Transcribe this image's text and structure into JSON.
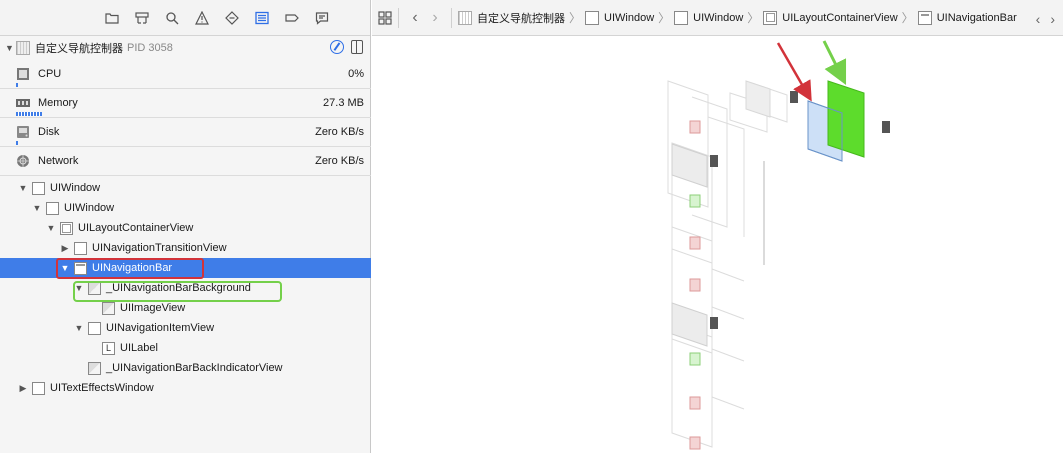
{
  "navigator": {
    "toolbar_icons": [
      "folder-icon",
      "hierarchy-icon",
      "search-icon",
      "warning-icon",
      "test-diamond-icon",
      "debug-list-icon",
      "breakpoint-icon",
      "log-icon"
    ],
    "active_icon": "debug-list-icon",
    "process": {
      "name": "自定义导航控制器",
      "pid": "PID 3058"
    },
    "gauges": [
      {
        "label": "CPU",
        "value": "0%",
        "icon": "cpu-icon"
      },
      {
        "label": "Memory",
        "value": "27.3 MB",
        "icon": "memory-icon"
      },
      {
        "label": "Disk",
        "value": "Zero KB/s",
        "icon": "disk-icon"
      },
      {
        "label": "Network",
        "value": "Zero KB/s",
        "icon": "network-icon"
      }
    ],
    "tree": [
      {
        "label": "UIWindow",
        "depth": 0,
        "expanded": true,
        "icon": "plain"
      },
      {
        "label": "UIWindow",
        "depth": 1,
        "expanded": true,
        "icon": "plain"
      },
      {
        "label": "UILayoutContainerView",
        "depth": 2,
        "expanded": true,
        "icon": "inner"
      },
      {
        "label": "UINavigationTransitionView",
        "depth": 3,
        "expanded": false,
        "icon": "plain"
      },
      {
        "label": "UINavigationBar",
        "depth": 3,
        "expanded": true,
        "icon": "bar",
        "selected": true
      },
      {
        "label": "_UINavigationBarBackground",
        "depth": 4,
        "expanded": true,
        "icon": "img"
      },
      {
        "label": "UIImageView",
        "depth": 5,
        "expanded": null,
        "icon": "img"
      },
      {
        "label": "UINavigationItemView",
        "depth": 4,
        "expanded": true,
        "icon": "plain"
      },
      {
        "label": "UILabel",
        "depth": 5,
        "expanded": null,
        "icon": "letter"
      },
      {
        "label": "_UINavigationBarBackIndicatorView",
        "depth": 4,
        "expanded": null,
        "icon": "img"
      },
      {
        "label": "UITextEffectsWindow",
        "depth": 0,
        "expanded": false,
        "icon": "plain"
      }
    ],
    "letter_icon_text": "L"
  },
  "jumpbar": {
    "crumbs": [
      {
        "label": "自定义导航控制器",
        "icon": "proc"
      },
      {
        "label": "UIWindow",
        "icon": "plain"
      },
      {
        "label": "UIWindow",
        "icon": "plain"
      },
      {
        "label": "UILayoutContainerView",
        "icon": "inner"
      },
      {
        "label": "UINavigationBar",
        "icon": "bar"
      }
    ]
  },
  "colors": {
    "selection": "#3f7de8",
    "annotation_red": "#d2333a",
    "annotation_green": "#74d04a",
    "selected_view_fill": "#cde0f7",
    "green_view_fill": "#5ddc2c"
  }
}
